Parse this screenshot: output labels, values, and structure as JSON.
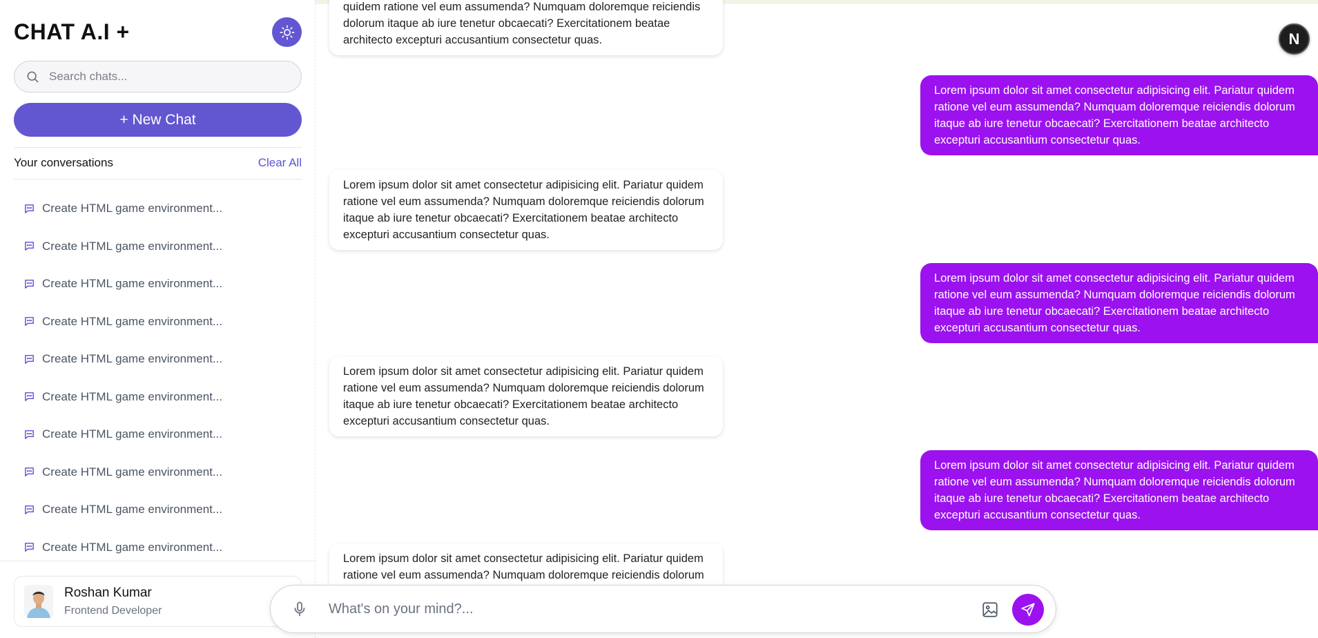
{
  "sidebar": {
    "brand": "CHAT A.I +",
    "theme_toggle_icon": "sun-icon",
    "search": {
      "placeholder": "Search chats..."
    },
    "new_chat_label": "+ New Chat",
    "conversations_title": "Your conversations",
    "clear_all_label": "Clear All",
    "conversations": [
      {
        "label": "Create HTML game environment..."
      },
      {
        "label": "Create HTML game environment..."
      },
      {
        "label": "Create HTML game environment..."
      },
      {
        "label": "Create HTML game environment..."
      },
      {
        "label": "Create HTML game environment..."
      },
      {
        "label": "Create HTML game environment..."
      },
      {
        "label": "Create HTML game environment..."
      },
      {
        "label": "Create HTML game environment..."
      },
      {
        "label": "Create HTML game environment..."
      },
      {
        "label": "Create HTML game environment..."
      }
    ],
    "profile": {
      "name": "Roshan Kumar",
      "role": "Frontend Developer"
    }
  },
  "messages": [
    {
      "role": "bot",
      "text": "quidem ratione vel eum assumenda? Numquam doloremque reiciendis dolorum itaque ab iure tenetur obcaecati? Exercitationem beatae architecto excepturi accusantium consectetur quas."
    },
    {
      "role": "user",
      "text": "Lorem ipsum dolor sit amet consectetur adipisicing elit. Pariatur quidem ratione vel eum assumenda? Numquam doloremque reiciendis dolorum itaque ab iure tenetur obcaecati? Exercitationem beatae architecto excepturi accusantium consectetur quas."
    },
    {
      "role": "bot",
      "text": "Lorem ipsum dolor sit amet consectetur adipisicing elit. Pariatur quidem ratione vel eum assumenda? Numquam doloremque reiciendis dolorum itaque ab iure tenetur obcaecati? Exercitationem beatae architecto excepturi accusantium consectetur quas."
    },
    {
      "role": "user",
      "text": "Lorem ipsum dolor sit amet consectetur adipisicing elit. Pariatur quidem ratione vel eum assumenda? Numquam doloremque reiciendis dolorum itaque ab iure tenetur obcaecati? Exercitationem beatae architecto excepturi accusantium consectetur quas."
    },
    {
      "role": "bot",
      "text": "Lorem ipsum dolor sit amet consectetur adipisicing elit. Pariatur quidem ratione vel eum assumenda? Numquam doloremque reiciendis dolorum itaque ab iure tenetur obcaecati? Exercitationem beatae architecto excepturi accusantium consectetur quas."
    },
    {
      "role": "user",
      "text": "Lorem ipsum dolor sit amet consectetur adipisicing elit. Pariatur quidem ratione vel eum assumenda? Numquam doloremque reiciendis dolorum itaque ab iure tenetur obcaecati? Exercitationem beatae architecto excepturi accusantium consectetur quas."
    },
    {
      "role": "bot",
      "text": "Lorem ipsum dolor sit amet consectetur adipisicing elit. Pariatur quidem ratione vel eum assumenda? Numquam doloremque reiciendis dolorum itaque ab iure tenetur obcaecati? Exercitationem beatae architecto excepturi accusantium consectetur quas."
    }
  ],
  "composer": {
    "placeholder": "What's on your mind?..."
  },
  "badge": {
    "letter": "N"
  },
  "colors": {
    "accent": "#6356d1",
    "user_bubble": "#9b12ef"
  }
}
